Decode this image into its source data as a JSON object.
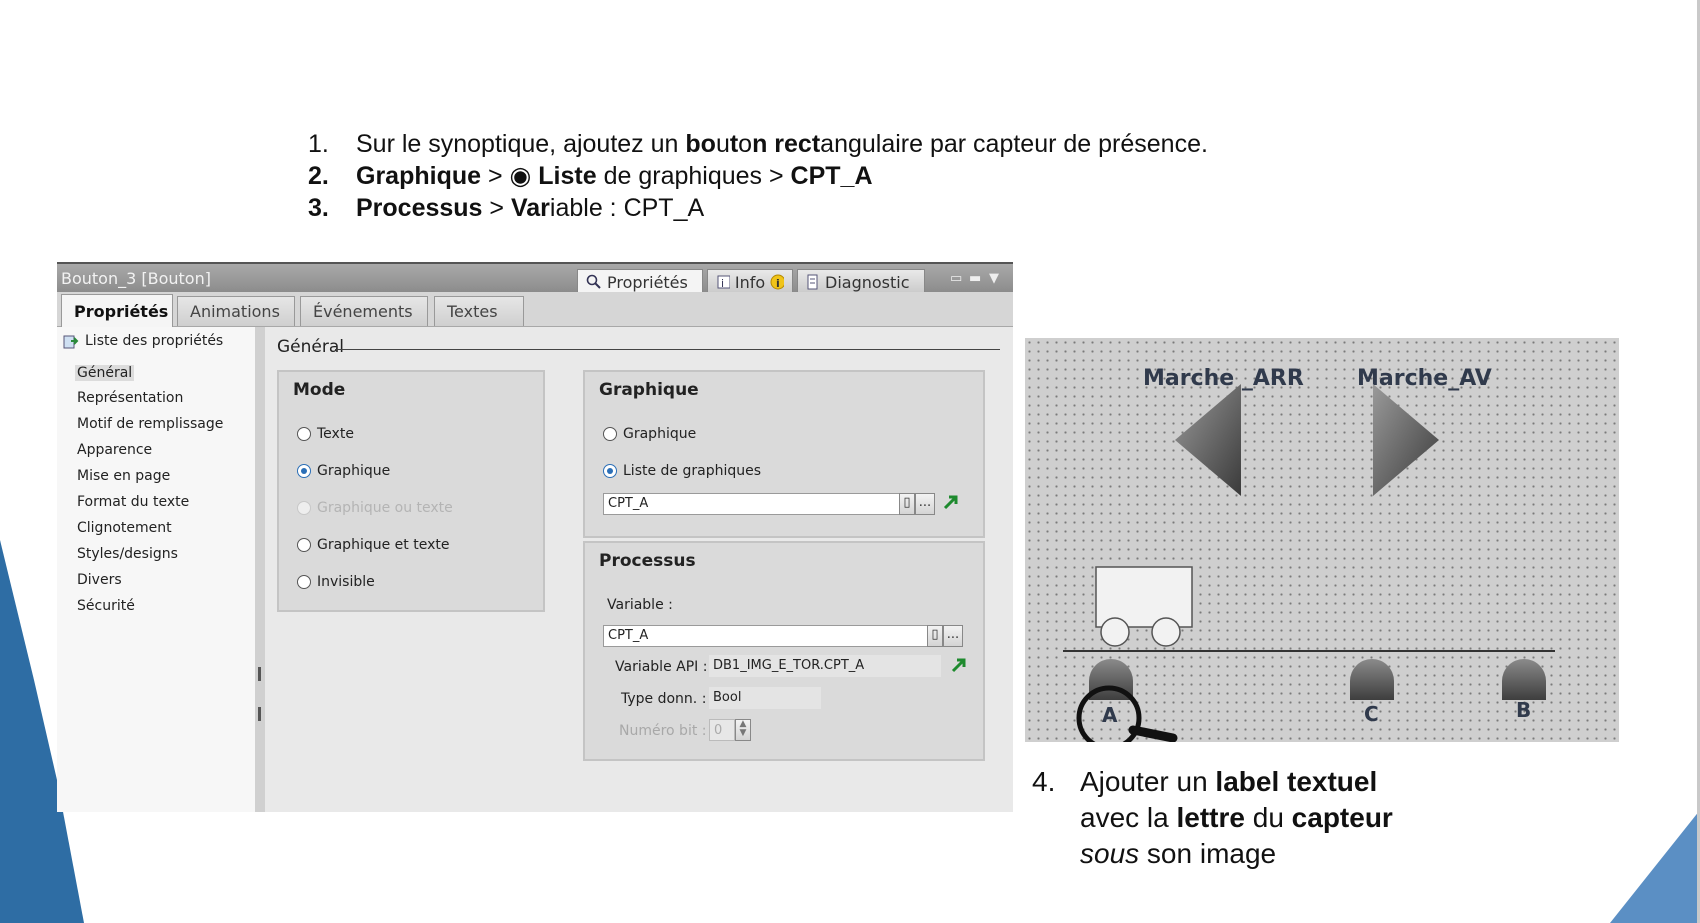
{
  "instructions": {
    "steps": [
      {
        "num": "1.",
        "parts": [
          {
            "t": "Sur le synoptique, ajoutez un ",
            "b": false
          },
          {
            "t": "bo",
            "b": true
          },
          {
            "t": "u",
            "b": false
          },
          {
            "t": "t",
            "b": true
          },
          {
            "t": "o",
            "b": false
          },
          {
            "t": "n rect",
            "b": true
          },
          {
            "t": "angulaire par capteur de présence.",
            "b": false
          }
        ]
      },
      {
        "num": "2.",
        "parts": [
          {
            "t": "Graphique",
            "b": true
          },
          {
            "t": " > ◉ ",
            "b": false
          },
          {
            "t": "Liste",
            "b": true
          },
          {
            "t": " de graphiques > ",
            "b": false
          },
          {
            "t": "CPT_A",
            "b": true
          }
        ]
      },
      {
        "num": "3.",
        "parts": [
          {
            "t": "Processus",
            "b": true
          },
          {
            "t": " > ",
            "b": false
          },
          {
            "t": "Var",
            "b": true
          },
          {
            "t": "iable : CPT_A",
            "b": false
          }
        ]
      }
    ],
    "step4": {
      "num": "4.",
      "lines": [
        [
          {
            "t": "Ajouter un ",
            "s": "n"
          },
          {
            "t": "label textuel",
            "s": "b"
          }
        ],
        [
          {
            "t": "avec la ",
            "s": "n"
          },
          {
            "t": "lettre",
            "s": "b"
          },
          {
            "t": " du ",
            "s": "n"
          },
          {
            "t": "capteur",
            "s": "b"
          }
        ],
        [
          {
            "t": "sous",
            "s": "i"
          },
          {
            "t": " son image",
            "s": "n"
          }
        ]
      ]
    }
  },
  "panel": {
    "window_title": "Bouton_3 [Bouton]",
    "top_tabs": {
      "properties": "Propriétés",
      "info": "Info",
      "diagnostic": "Diagnostic"
    },
    "sub_tabs": [
      "Propriétés",
      "Animations",
      "Événements",
      "Textes"
    ],
    "nav": {
      "header": "Liste des propriétés",
      "items": [
        "Général",
        "Représentation",
        "Motif de remplissage",
        "Apparence",
        "Mise en page",
        "Format du texte",
        "Clignotement",
        "Styles/designs",
        "Divers",
        "Sécurité"
      ]
    },
    "section_title": "Général",
    "mode": {
      "title": "Mode",
      "options": [
        {
          "label": "Texte",
          "state": "off"
        },
        {
          "label": "Graphique",
          "state": "on"
        },
        {
          "label": "Graphique ou texte",
          "state": "disabled"
        },
        {
          "label": "Graphique et texte",
          "state": "off"
        },
        {
          "label": "Invisible",
          "state": "off"
        }
      ]
    },
    "graphique": {
      "title": "Graphique",
      "options": [
        {
          "label": "Graphique",
          "state": "off"
        },
        {
          "label": "Liste de graphiques",
          "state": "on"
        }
      ],
      "list_value": "CPT_A"
    },
    "processus": {
      "title": "Processus",
      "variable_label": "Variable :",
      "variable_value": "CPT_A",
      "api_label": "Variable API :",
      "api_value": "DB1_IMG_E_TOR.CPT_A",
      "type_label": "Type donn. :",
      "type_value": "Bool",
      "bit_label": "Numéro bit :",
      "bit_value": "0"
    },
    "small_button": "..."
  },
  "hmi": {
    "label_back": "Marche _ARR",
    "label_fwd": "Marche_AV",
    "sensors": [
      "A",
      "C",
      "B"
    ]
  },
  "colors": {
    "accent_blue": "#2e6da4",
    "hmi_background": "#cfcfcf",
    "radio_checked": "#2b6fb7",
    "link_green": "#1e8a2e"
  }
}
